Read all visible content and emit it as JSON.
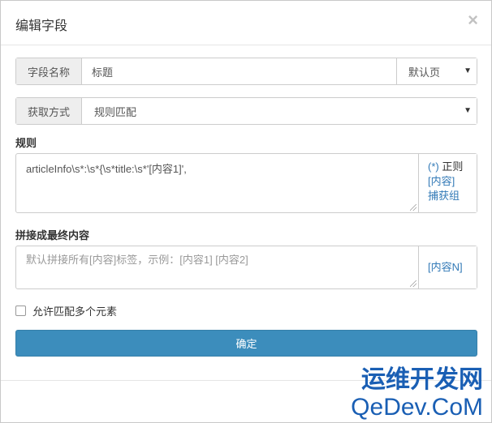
{
  "dialog": {
    "title": "编辑字段",
    "close_glyph": "×"
  },
  "field_name": {
    "label": "字段名称",
    "value": "标题",
    "page_select": "默认页",
    "caret": "▼"
  },
  "fetch_method": {
    "label": "获取方式",
    "value": "规则匹配",
    "caret": "▼"
  },
  "rule": {
    "label": "规则",
    "value": "articleInfo\\s*:\\s*{\\s*title:\\s*'[内容1]',",
    "help_regex_link": "(*)",
    "help_regex_text": "正则",
    "help_content_link": "[内容]",
    "help_capture_link": "捕获组"
  },
  "concat": {
    "label": "拼接成最终内容",
    "placeholder": "默认拼接所有[内容]标签，示例：[内容1] [内容2]",
    "help_link": "[内容N]"
  },
  "allow_multiple": {
    "label": "允许匹配多个元素",
    "checked": false
  },
  "confirm_button": {
    "label": "确定"
  },
  "watermark": {
    "line1": "运维开发网",
    "line2": "QeDev.CoM"
  }
}
